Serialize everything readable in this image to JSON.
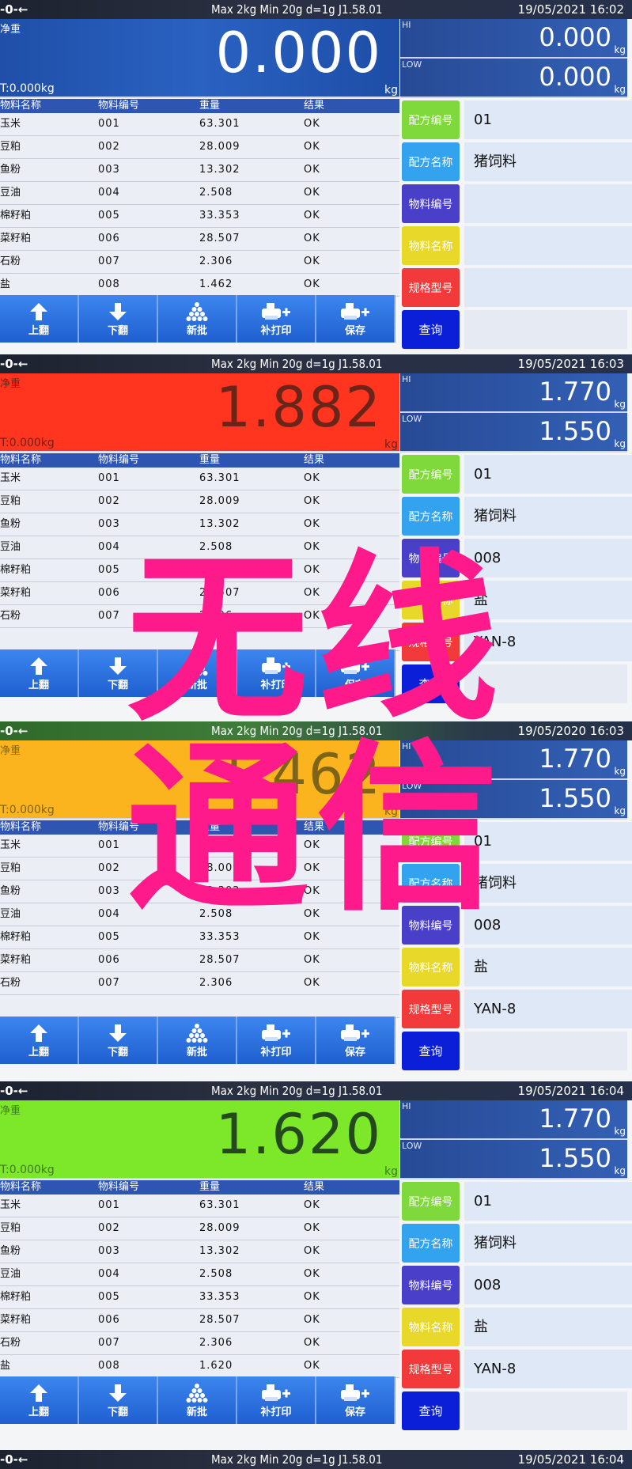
{
  "common": {
    "spec": "Max 2kg  Min 20g  d=1g    J1.58.01",
    "zero_indicator": "-0-←",
    "net_label": "净重",
    "tare": "T:0.000kg",
    "unit": "kg",
    "hi_label": "HI",
    "low_label": "LOW",
    "columns": [
      "物料名称",
      "物料编号",
      "重量",
      "结果"
    ],
    "actions": [
      {
        "label": "上翻",
        "icon": "arrow-up-icon"
      },
      {
        "label": "下翻",
        "icon": "arrow-down-icon"
      },
      {
        "label": "新批",
        "icon": "stack-icon"
      },
      {
        "label": "补打印",
        "icon": "printer-plus-icon"
      },
      {
        "label": "保存",
        "icon": "printer-plus-icon"
      }
    ],
    "field_labels": [
      "配方编号",
      "配方名称",
      "物料编号",
      "物料名称",
      "规格型号"
    ],
    "field_colors": [
      "#7fd83c",
      "#33a3f0",
      "#4a3fc8",
      "#e8d82a",
      "#f23a3a"
    ],
    "query_label": "查询"
  },
  "panels": [
    {
      "datetime": "19/05/2021  16:02",
      "weight": "0.000",
      "display_color": "blue",
      "hi": "0.000",
      "low": "0.000",
      "rows": [
        [
          "玉米",
          "001",
          "63.301",
          "OK"
        ],
        [
          "豆粕",
          "002",
          "28.009",
          "OK"
        ],
        [
          "鱼粉",
          "003",
          "13.302",
          "OK"
        ],
        [
          "豆油",
          "004",
          "2.508",
          "OK"
        ],
        [
          "棉籽粕",
          "005",
          "33.353",
          "OK"
        ],
        [
          "菜籽粕",
          "006",
          "28.507",
          "OK"
        ],
        [
          "石粉",
          "007",
          "2.306",
          "OK"
        ],
        [
          "盐",
          "008",
          "1.462",
          "OK"
        ]
      ],
      "fields": [
        "01",
        "猪饲料",
        "",
        "",
        ""
      ]
    },
    {
      "datetime": "19/05/2021  16:03",
      "weight": "1.882",
      "display_color": "red",
      "hi": "1.770",
      "low": "1.550",
      "rows": [
        [
          "玉米",
          "001",
          "63.301",
          "OK"
        ],
        [
          "豆粕",
          "002",
          "28.009",
          "OK"
        ],
        [
          "鱼粉",
          "003",
          "13.302",
          "OK"
        ],
        [
          "豆油",
          "004",
          "2.508",
          "OK"
        ],
        [
          "棉籽粕",
          "005",
          "33.353",
          "OK"
        ],
        [
          "菜籽粕",
          "006",
          "28.507",
          "OK"
        ],
        [
          "石粉",
          "007",
          "2.306",
          "OK"
        ],
        [
          "",
          "",
          "",
          ""
        ]
      ],
      "fields": [
        "01",
        "猪饲料",
        "008",
        "盐",
        "YAN-8"
      ]
    },
    {
      "datetime": "19/05/2020  16:03",
      "weight": "1.462",
      "display_color": "orange",
      "hi": "1.770",
      "low": "1.550",
      "rows": [
        [
          "玉米",
          "001",
          "63.301",
          "OK"
        ],
        [
          "豆粕",
          "002",
          "28.009",
          "OK"
        ],
        [
          "鱼粉",
          "003",
          "13.302",
          "OK"
        ],
        [
          "豆油",
          "004",
          "2.508",
          "OK"
        ],
        [
          "棉籽粕",
          "005",
          "33.353",
          "OK"
        ],
        [
          "菜籽粕",
          "006",
          "28.507",
          "OK"
        ],
        [
          "石粉",
          "007",
          "2.306",
          "OK"
        ],
        [
          "",
          "",
          "",
          ""
        ]
      ],
      "fields": [
        "01",
        "猪饲料",
        "008",
        "盐",
        "YAN-8"
      ]
    },
    {
      "datetime": "19/05/2021  16:04",
      "weight": "1.620",
      "display_color": "lime",
      "hi": "1.770",
      "low": "1.550",
      "rows": [
        [
          "玉米",
          "001",
          "63.301",
          "OK"
        ],
        [
          "豆粕",
          "002",
          "28.009",
          "OK"
        ],
        [
          "鱼粉",
          "003",
          "13.302",
          "OK"
        ],
        [
          "豆油",
          "004",
          "2.508",
          "OK"
        ],
        [
          "棉籽粕",
          "005",
          "33.353",
          "OK"
        ],
        [
          "菜籽粕",
          "006",
          "28.507",
          "OK"
        ],
        [
          "石粉",
          "007",
          "2.306",
          "OK"
        ],
        [
          "盐",
          "008",
          "1.620",
          "OK"
        ]
      ],
      "fields": [
        "01",
        "猪饲料",
        "008",
        "盐",
        "YAN-8"
      ]
    }
  ],
  "footer_status": {
    "datetime": "19/05/2021  16:04"
  },
  "watermark": [
    "无线",
    "通信"
  ]
}
